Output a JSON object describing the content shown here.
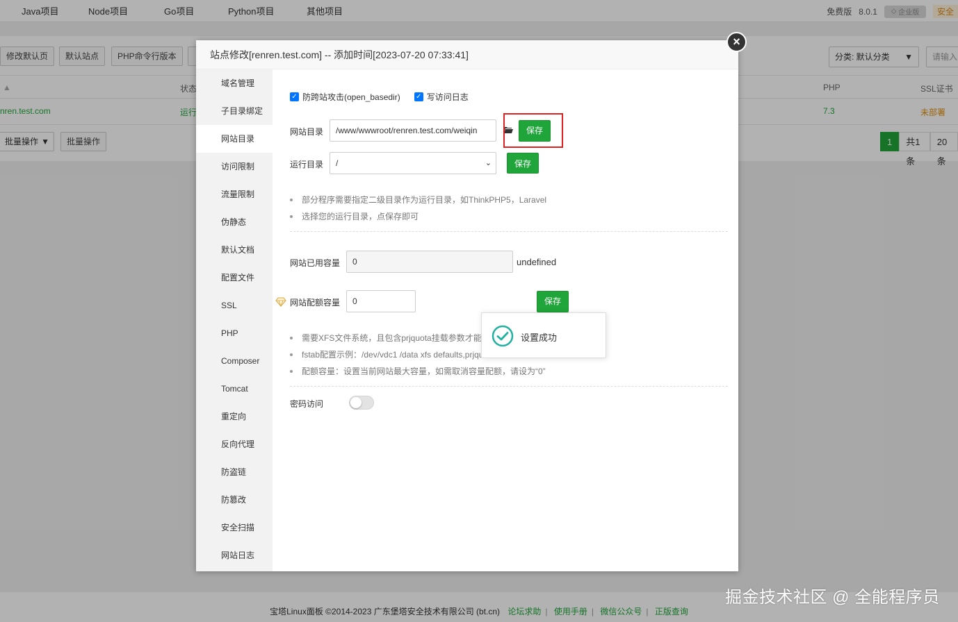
{
  "top_tabs": [
    "Java项目",
    "Node项目",
    "Go项目",
    "Python项目",
    "其他项目"
  ],
  "top_right": {
    "edition": "免费版",
    "version": "8.0.1",
    "badge": "企业版",
    "safe": "安全"
  },
  "toolbar": {
    "buttons": [
      "修改默认页",
      "默认站点",
      "PHP命令行版本"
    ],
    "category_select": "分类: 默认分类",
    "search_placeholder": "请输入"
  },
  "table": {
    "headers": {
      "status": "状态",
      "php": "PHP",
      "ssl": "SSL证书"
    },
    "row": {
      "site": "nren.test.com",
      "status": "运行",
      "php": "7.3",
      "ssl": "未部署"
    },
    "batch_select": "批量操作",
    "batch_button": "批量操作"
  },
  "pager": {
    "page": "1",
    "total": "共1条",
    "per_page": "20条"
  },
  "footer": {
    "copyright": "宝塔Linux面板 ©2014-2023 广东堡塔安全技术有限公司 (bt.cn)",
    "links": [
      "论坛求助",
      "使用手册",
      "微信公众号",
      "正版查询"
    ]
  },
  "watermark": "掘金技术社区 @ 全能程序员",
  "modal": {
    "title": "站点修改[renren.test.com] -- 添加时间[2023-07-20 07:33:41]",
    "close_glyph": "×",
    "sidebar": [
      "域名管理",
      "子目录绑定",
      "网站目录",
      "访问限制",
      "流量限制",
      "伪静态",
      "默认文档",
      "配置文件",
      "SSL",
      "PHP",
      "Composer",
      "Tomcat",
      "重定向",
      "反向代理",
      "防盗链",
      "防篡改",
      "安全扫描",
      "网站日志"
    ],
    "active_item": "网站目录",
    "checkboxes": {
      "open_basedir": "防跨站攻击(open_basedir)",
      "access_log": "写访问日志"
    },
    "site_dir": {
      "label": "网站目录",
      "value": "/www/wwwroot/renren.test.com/weiqin",
      "save": "保存"
    },
    "run_dir": {
      "label": "运行目录",
      "value": "/",
      "save": "保存"
    },
    "tips1": [
      "部分程序需要指定二级目录作为运行目录，如ThinkPHP5，Laravel",
      "选择您的运行目录，点保存即可"
    ],
    "used_quota": {
      "label": "网站已用容量",
      "value": "0",
      "unit": "undefined"
    },
    "quota": {
      "label": "网站配额容量",
      "value": "0",
      "save": "保存"
    },
    "tips2": [
      "需要XFS文件系统，且包含prjquota挂载参数才能使用",
      "fstab配置示例：/dev/vdc1 /data xfs defaults,prjquota 0 0",
      "配额容量：设置当前网站最大容量，如需取消容量配额，请设为“0”"
    ],
    "password_access": {
      "label": "密码访问",
      "enabled": false
    },
    "toast": "设置成功"
  },
  "colors": {
    "brand_green": "#20a53a",
    "highlight_red": "#e02020",
    "check_blue": "#0075ff"
  }
}
